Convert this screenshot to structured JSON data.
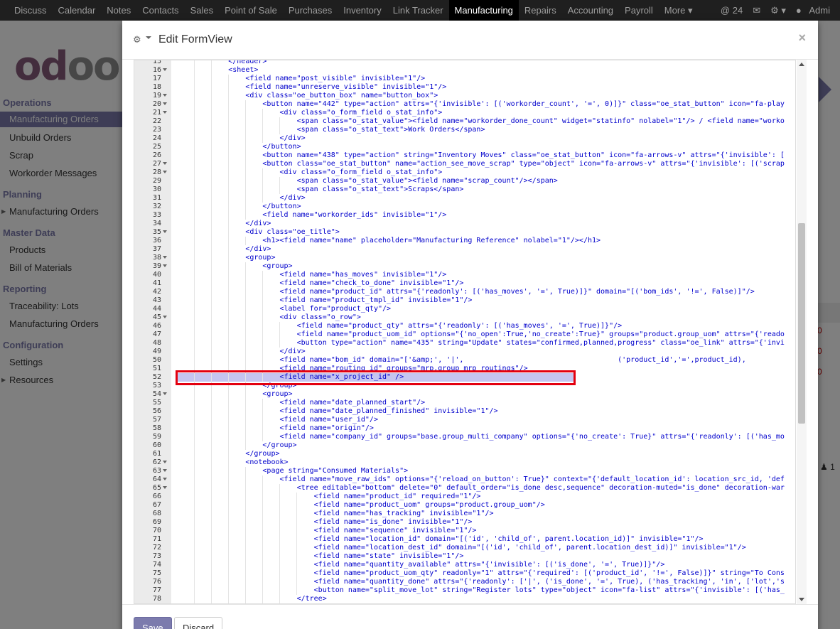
{
  "navbar": {
    "items": [
      "Discuss",
      "Calendar",
      "Notes",
      "Contacts",
      "Sales",
      "Point of Sale",
      "Purchases",
      "Inventory",
      "Link Tracker",
      "Manufacturing",
      "Repairs",
      "Accounting",
      "Payroll",
      "More ▾"
    ],
    "active_index": 9,
    "messages_count": "@ 24",
    "user": "Admi"
  },
  "sidebar": {
    "logo": "odoo",
    "sections": [
      {
        "title": "Operations",
        "items": [
          "Manufacturing Orders",
          "Unbuild Orders",
          "Scrap",
          "Workorder Messages"
        ]
      },
      {
        "title": "Planning",
        "items": [
          "Manufacturing Orders"
        ]
      },
      {
        "title": "Master Data",
        "items": [
          "Products",
          "Bill of Materials"
        ]
      },
      {
        "title": "Reporting",
        "items": [
          "Traceability: Lots",
          "Manufacturing Orders"
        ]
      },
      {
        "title": "Configuration",
        "items": [
          "Settings",
          "Resources"
        ]
      }
    ]
  },
  "background": {
    "red_values": [
      "0",
      "0",
      "0"
    ],
    "count": "1"
  },
  "modal": {
    "title": "Edit FormView",
    "close": "×",
    "save_label": "Save",
    "discard_label": "Discard"
  },
  "editor": {
    "selected_line": 52,
    "lines": [
      {
        "n": 15,
        "f": false,
        "t": "            </header>"
      },
      {
        "n": 16,
        "f": true,
        "t": "            <sheet>"
      },
      {
        "n": 17,
        "f": false,
        "t": "                <field name=\"post_visible\" invisible=\"1\"/>"
      },
      {
        "n": 18,
        "f": false,
        "t": "                <field name=\"unreserve_visible\" invisible=\"1\"/>"
      },
      {
        "n": 19,
        "f": true,
        "t": "                <div class=\"oe_button_box\" name=\"button_box\">"
      },
      {
        "n": 20,
        "f": true,
        "t": "                    <button name=\"442\" type=\"action\" attrs=\"{'invisible': [('workorder_count', '=', 0)]}\" class=\"oe_stat_button\" icon=\"fa-play"
      },
      {
        "n": 21,
        "f": true,
        "t": "                        <div class=\"o_form_field o_stat_info\">"
      },
      {
        "n": 22,
        "f": false,
        "t": "                            <span class=\"o_stat_value\"><field name=\"workorder_done_count\" widget=\"statinfo\" nolabel=\"1\"/> / <field name=\"worko"
      },
      {
        "n": 23,
        "f": false,
        "t": "                            <span class=\"o_stat_text\">Work Orders</span>"
      },
      {
        "n": 24,
        "f": false,
        "t": "                        </div>"
      },
      {
        "n": 25,
        "f": false,
        "t": "                    </button>"
      },
      {
        "n": 26,
        "f": false,
        "t": "                    <button name=\"438\" type=\"action\" string=\"Inventory Moves\" class=\"oe_stat_button\" icon=\"fa-arrows-v\" attrs=\"{'invisible': ["
      },
      {
        "n": 27,
        "f": true,
        "t": "                    <button class=\"oe_stat_button\" name=\"action_see_move_scrap\" type=\"object\" icon=\"fa-arrows-v\" attrs=\"{'invisible': [('scrap"
      },
      {
        "n": 28,
        "f": true,
        "t": "                        <div class=\"o_form_field o_stat_info\">"
      },
      {
        "n": 29,
        "f": false,
        "t": "                            <span class=\"o_stat_value\"><field name=\"scrap_count\"/></span>"
      },
      {
        "n": 30,
        "f": false,
        "t": "                            <span class=\"o_stat_text\">Scraps</span>"
      },
      {
        "n": 31,
        "f": false,
        "t": "                        </div>"
      },
      {
        "n": 32,
        "f": false,
        "t": "                    </button>"
      },
      {
        "n": 33,
        "f": false,
        "t": "                    <field name=\"workorder_ids\" invisible=\"1\"/>"
      },
      {
        "n": 34,
        "f": false,
        "t": "                </div>"
      },
      {
        "n": 35,
        "f": true,
        "t": "                <div class=\"oe_title\">"
      },
      {
        "n": 36,
        "f": false,
        "t": "                    <h1><field name=\"name\" placeholder=\"Manufacturing Reference\" nolabel=\"1\"/></h1>"
      },
      {
        "n": 37,
        "f": false,
        "t": "                </div>"
      },
      {
        "n": 38,
        "f": true,
        "t": "                <group>"
      },
      {
        "n": 39,
        "f": true,
        "t": "                    <group>"
      },
      {
        "n": 40,
        "f": false,
        "t": "                        <field name=\"has_moves\" invisible=\"1\"/>"
      },
      {
        "n": 41,
        "f": false,
        "t": "                        <field name=\"check_to_done\" invisible=\"1\"/>"
      },
      {
        "n": 42,
        "f": false,
        "t": "                        <field name=\"product_id\" attrs=\"{'readonly': [('has_moves', '=', True)]}\" domain=\"[('bom_ids', '!=', False)]\"/>"
      },
      {
        "n": 43,
        "f": false,
        "t": "                        <field name=\"product_tmpl_id\" invisible=\"1\"/>"
      },
      {
        "n": 44,
        "f": false,
        "t": "                        <label for=\"product_qty\"/>"
      },
      {
        "n": 45,
        "f": true,
        "t": "                        <div class=\"o_row\">"
      },
      {
        "n": 46,
        "f": false,
        "t": "                            <field name=\"product_qty\" attrs=\"{'readonly': [('has_moves', '=', True)]}\"/>"
      },
      {
        "n": 47,
        "f": false,
        "t": "                            <field name=\"product_uom_id\" options=\"{'no_open':True,'no_create':True}\" groups=\"product.group_uom\" attrs=\"{'reado"
      },
      {
        "n": 48,
        "f": false,
        "t": "                            <button type=\"action\" name=\"435\" string=\"Update\" states=\"confirmed,planned,progress\" class=\"oe_link\" attrs=\"{'invi"
      },
      {
        "n": 49,
        "f": false,
        "t": "                        </div>"
      },
      {
        "n": 50,
        "f": false,
        "t": "                        <field name=\"bom_id\" domain=\"['&amp;', '|',                                    ('product_id','=',product_id),"
      },
      {
        "n": 51,
        "f": false,
        "t": "                        <field name=\"routing_id\" groups=\"mrp.group_mrp_routings\"/>"
      },
      {
        "n": 52,
        "f": false,
        "t": "                        <field name=\"x_project_id\" />"
      },
      {
        "n": 53,
        "f": false,
        "t": "                    </group>"
      },
      {
        "n": 54,
        "f": true,
        "t": "                    <group>"
      },
      {
        "n": 55,
        "f": false,
        "t": "                        <field name=\"date_planned_start\"/>"
      },
      {
        "n": 56,
        "f": false,
        "t": "                        <field name=\"date_planned_finished\" invisible=\"1\"/>"
      },
      {
        "n": 57,
        "f": false,
        "t": "                        <field name=\"user_id\"/>"
      },
      {
        "n": 58,
        "f": false,
        "t": "                        <field name=\"origin\"/>"
      },
      {
        "n": 59,
        "f": false,
        "t": "                        <field name=\"company_id\" groups=\"base.group_multi_company\" options=\"{'no_create': True}\" attrs=\"{'readonly': [('has_mo"
      },
      {
        "n": 60,
        "f": false,
        "t": "                    </group>"
      },
      {
        "n": 61,
        "f": false,
        "t": "                </group>"
      },
      {
        "n": 62,
        "f": true,
        "t": "                <notebook>"
      },
      {
        "n": 63,
        "f": true,
        "t": "                    <page string=\"Consumed Materials\">"
      },
      {
        "n": 64,
        "f": true,
        "t": "                        <field name=\"move_raw_ids\" options=\"{'reload_on_button': True}\" context=\"{'default_location_id': location_src_id, 'def"
      },
      {
        "n": 65,
        "f": true,
        "t": "                            <tree editable=\"bottom\" delete=\"0\" default_order=\"is_done desc,sequence\" decoration-muted=\"is_done\" decoration-war"
      },
      {
        "n": 66,
        "f": false,
        "t": "                                <field name=\"product_id\" required=\"1\"/>"
      },
      {
        "n": 67,
        "f": false,
        "t": "                                <field name=\"product_uom\" groups=\"product.group_uom\"/>"
      },
      {
        "n": 68,
        "f": false,
        "t": "                                <field name=\"has_tracking\" invisible=\"1\"/>"
      },
      {
        "n": 69,
        "f": false,
        "t": "                                <field name=\"is_done\" invisible=\"1\"/>"
      },
      {
        "n": 70,
        "f": false,
        "t": "                                <field name=\"sequence\" invisible=\"1\"/>"
      },
      {
        "n": 71,
        "f": false,
        "t": "                                <field name=\"location_id\" domain=\"[('id', 'child_of', parent.location_id)]\" invisible=\"1\"/>"
      },
      {
        "n": 72,
        "f": false,
        "t": "                                <field name=\"location_dest_id\" domain=\"[('id', 'child_of', parent.location_dest_id)]\" invisible=\"1\"/>"
      },
      {
        "n": 73,
        "f": false,
        "t": "                                <field name=\"state\" invisible=\"1\"/>"
      },
      {
        "n": 74,
        "f": false,
        "t": "                                <field name=\"quantity_available\" attrs=\"{'invisible': [('is_done', '=', True)]}\"/>"
      },
      {
        "n": 75,
        "f": false,
        "t": "                                <field name=\"product_uom_qty\" readonly=\"1\" attrs=\"{'required': [('product_id', '!=', False)]}\" string=\"To Cons"
      },
      {
        "n": 76,
        "f": false,
        "t": "                                <field name=\"quantity_done\" attrs=\"{'readonly': ['|', ('is_done', '=', True), ('has_tracking', 'in', ['lot','s"
      },
      {
        "n": 77,
        "f": false,
        "t": "                                <button name=\"split_move_lot\" string=\"Register lots\" type=\"object\" icon=\"fa-list\" attrs=\"{'invisible': [('has_"
      },
      {
        "n": 78,
        "f": false,
        "t": "                            </tree>"
      }
    ]
  }
}
